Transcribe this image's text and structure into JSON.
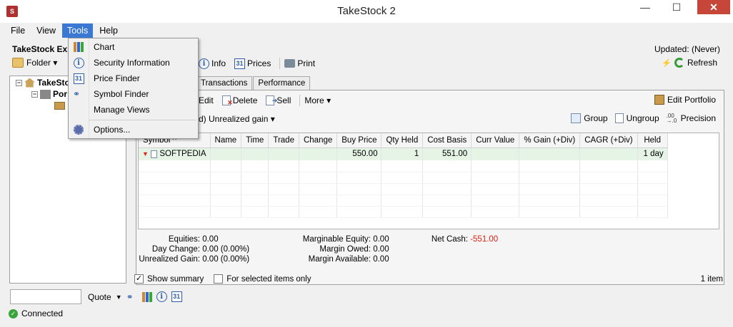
{
  "window": {
    "title": "TakeStock 2",
    "app_icon": "S",
    "minimize": "—",
    "maximize": "☐",
    "close": "✕"
  },
  "menu": {
    "items": [
      "File",
      "View",
      "Tools",
      "Help"
    ],
    "active": "Tools"
  },
  "tools_menu": {
    "items": [
      {
        "label": "Chart",
        "icon": "chart-icon"
      },
      {
        "label": "Security Information",
        "icon": "info-icon"
      },
      {
        "label": "Price Finder",
        "icon": "calendar-icon"
      },
      {
        "label": "Symbol Finder",
        "icon": "binoculars-icon"
      },
      {
        "label": "Manage Views",
        "icon": "manage-views-icon"
      },
      {
        "label": "Options...",
        "icon": "gear-icon"
      }
    ]
  },
  "header": {
    "left_title": "TakeStock Exp",
    "updated": "Updated: (Never)"
  },
  "folder_btn": "Folder ▾",
  "toolbar": {
    "info": "Info",
    "prices": "Prices",
    "print": "Print",
    "refresh": "Refresh",
    "calendar_day": "31"
  },
  "tree": {
    "root": "TakeSto",
    "portfolio": "Por"
  },
  "tabs": [
    "Transactions",
    "Performance"
  ],
  "actions": {
    "edit": "Edit",
    "delete": "Delete",
    "sell": "Sell",
    "more": "More ▾",
    "edit_portfolio": "Edit Portfolio"
  },
  "view": {
    "selector": "d) Unrealized gain ▾",
    "group": "Group",
    "ungroup": "Ungroup",
    "precision": "Precision"
  },
  "table": {
    "columns": [
      "Symbol ^",
      "Name",
      "Time",
      "Trade",
      "Change",
      "Buy Price",
      "Qty Held",
      "Cost Basis",
      "Curr Value",
      "% Gain (+Div)",
      "CAGR (+Div)",
      "Held"
    ],
    "rows": [
      [
        "SOFTPEDIA",
        "",
        "",
        "",
        "",
        "550.00",
        "1",
        "551.00",
        "",
        "",
        "",
        "1 day"
      ]
    ]
  },
  "summary": {
    "equities_lbl": "Equities:",
    "equities": "0.00",
    "day_change_lbl": "Day Change:",
    "day_change": "0.00",
    "day_change_pct": "(0.00%)",
    "unrealized_lbl": "Unrealized Gain:",
    "unrealized": "0.00",
    "unrealized_pct": "(0.00%)",
    "marg_eq_lbl": "Marginable Equity:",
    "marg_eq": "0.00",
    "marg_owed_lbl": "Margin Owed:",
    "marg_owed": "0.00",
    "marg_avail_lbl": "Margin Available:",
    "marg_avail": "0.00",
    "net_cash_lbl": "Net Cash:",
    "net_cash": "-551.00"
  },
  "options": {
    "show_summary": "Show summary",
    "show_summary_checked": true,
    "selected_only": "For selected items only",
    "selected_only_checked": false,
    "item_count": "1 item"
  },
  "quote": {
    "label": "Quote",
    "value": ""
  },
  "status": {
    "text": "Connected"
  },
  "colors": {
    "menu_highlight": "#3a78d4",
    "negative": "#d21",
    "selected_row": "#e6f4e6"
  }
}
